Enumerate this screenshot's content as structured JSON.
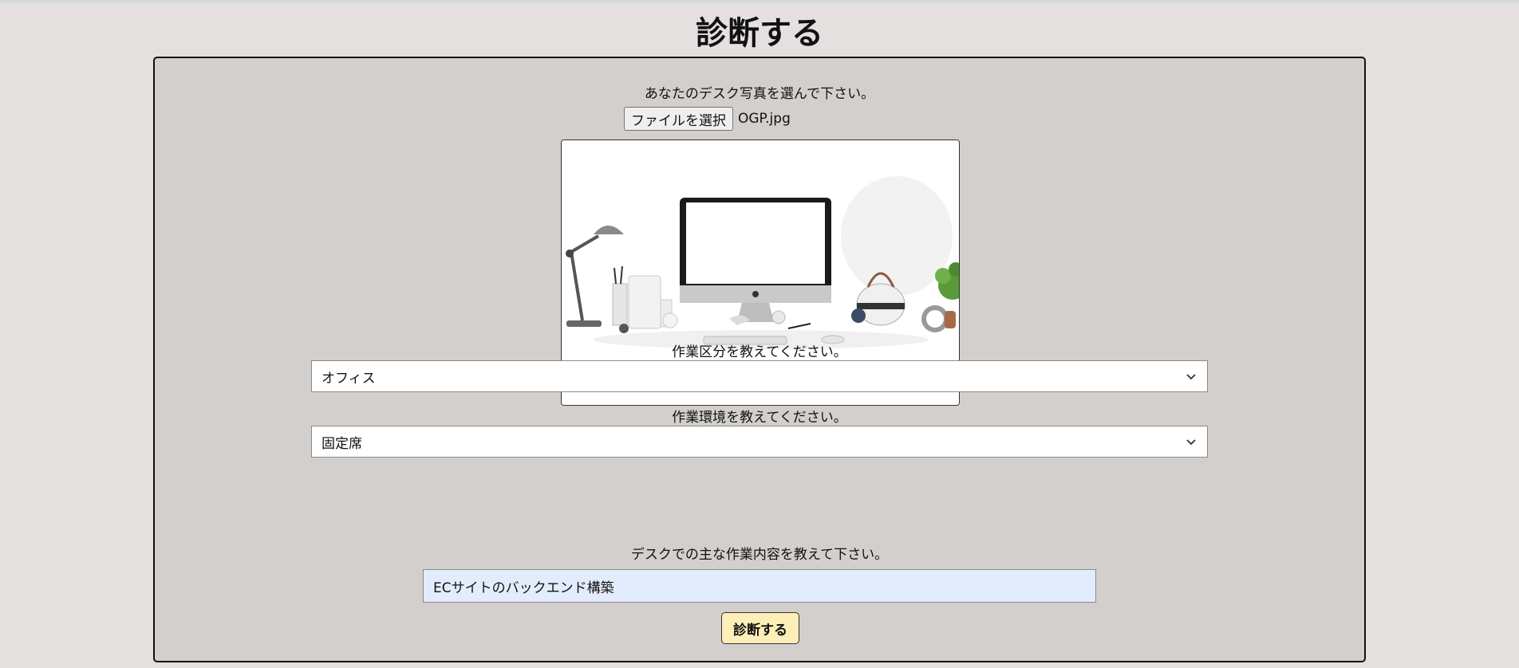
{
  "page": {
    "title": "診断する"
  },
  "photo": {
    "label": "あなたのデスク写真を選んで下さい。",
    "button_label": "ファイルを選択",
    "file_name": "OGP.jpg"
  },
  "work_type": {
    "label": "作業区分を教えてください。",
    "selected": "オフィス"
  },
  "environment": {
    "label": "作業環境を教えてください。",
    "selected": "固定席"
  },
  "task": {
    "label": "デスクでの主な作業内容を教えて下さい。",
    "value": "ECサイトのバックエンド構築"
  },
  "submit": {
    "label": "診断する"
  },
  "colors": {
    "background": "#e4e0df",
    "panel": "#d3cfcc",
    "submit": "#fdefb8",
    "input_fill": "#e3ecfc"
  }
}
